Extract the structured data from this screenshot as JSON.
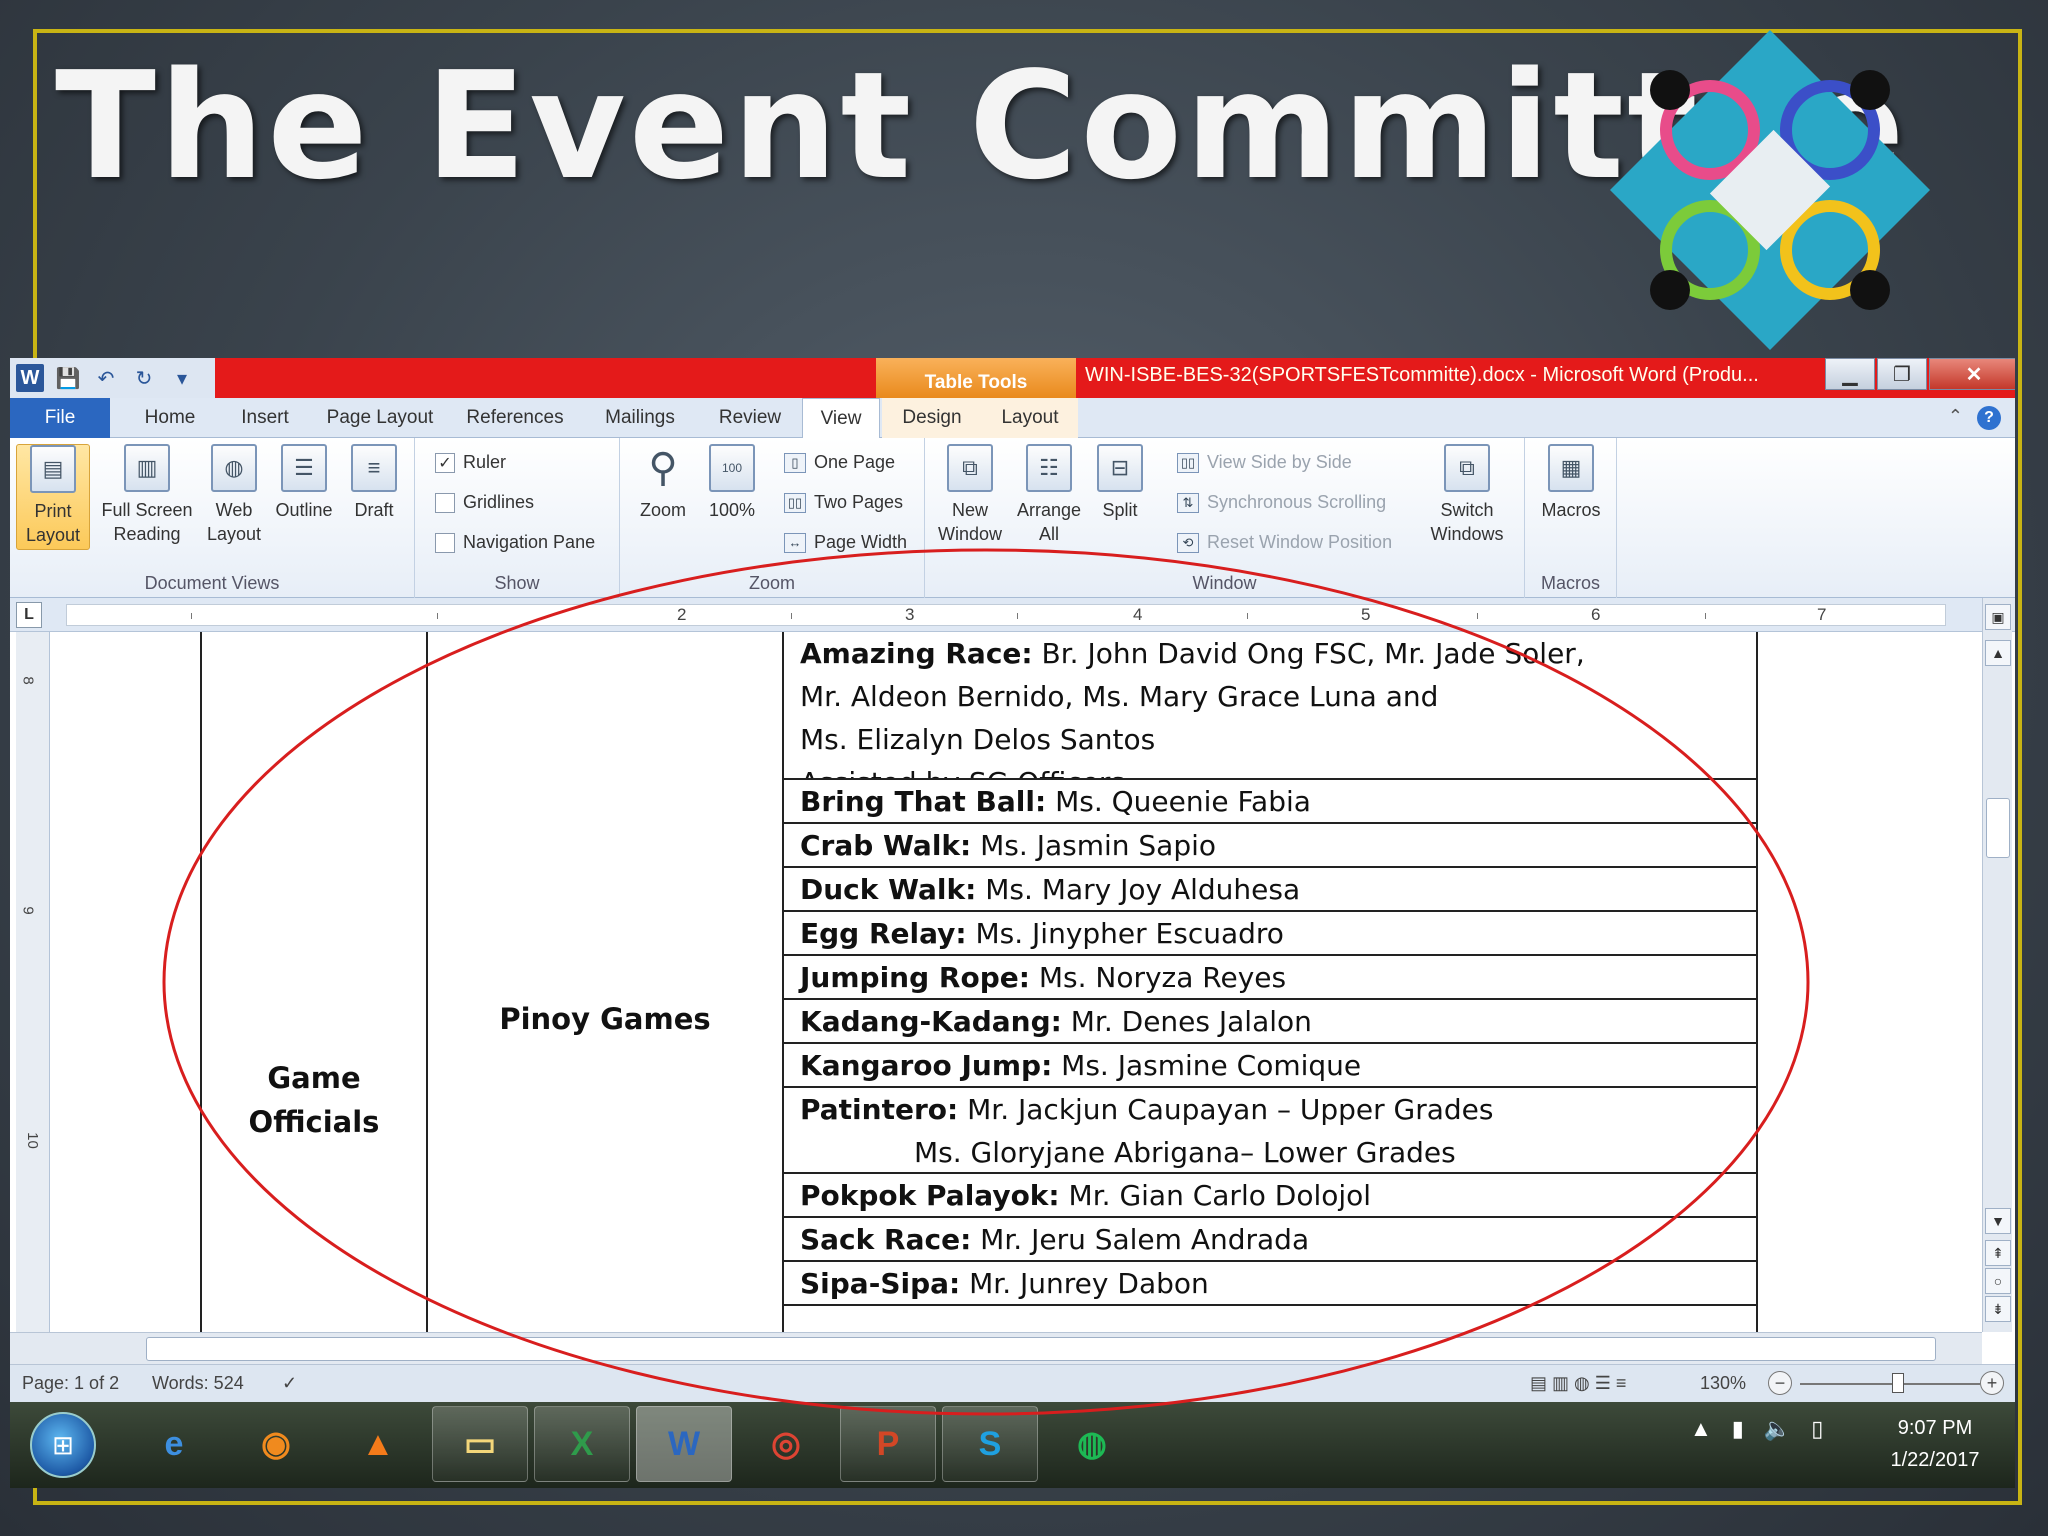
{
  "slide": {
    "title": "The Event Committee"
  },
  "word": {
    "quick_access": [
      "W",
      "💾",
      "↶",
      "↻"
    ],
    "context_tab": "Table Tools",
    "doc_title": "WIN-ISBE-BES-32(SPORTSFESTcommitte).docx - Microsoft Word (Produ...",
    "tabs": {
      "file": "File",
      "home": "Home",
      "insert": "Insert",
      "page_layout": "Page Layout",
      "references": "References",
      "mailings": "Mailings",
      "review": "Review",
      "view": "View",
      "design": "Design",
      "layout": "Layout"
    },
    "ribbon": {
      "doc_views": {
        "label": "Document Views",
        "print_layout": "Print Layout",
        "full_screen": "Full Screen Reading",
        "web_layout": "Web Layout",
        "outline": "Outline",
        "draft": "Draft"
      },
      "show": {
        "label": "Show",
        "ruler": "Ruler",
        "gridlines": "Gridlines",
        "nav_pane": "Navigation Pane"
      },
      "zoom": {
        "label": "Zoom",
        "zoom": "Zoom",
        "hundred": "100%",
        "one_page": "One Page",
        "two_pages": "Two Pages",
        "page_width": "Page Width"
      },
      "window": {
        "label": "Window",
        "new_window": "New Window",
        "arrange_all": "Arrange All",
        "split": "Split",
        "view_side": "View Side by Side",
        "sync_scroll": "Synchronous Scrolling",
        "reset_pos": "Reset Window Position",
        "switch_windows": "Switch Windows"
      },
      "macros": {
        "label": "Macros",
        "macros": "Macros"
      }
    },
    "ruler_numbers": [
      "2",
      "3",
      "4",
      "5",
      "6",
      "7"
    ],
    "vruler_numbers": [
      "8",
      "9",
      "10"
    ],
    "table": {
      "col1": "Game Officials",
      "col2": "Pinoy Games",
      "rows": [
        {
          "event": "Amazing Race:",
          "people": "  Br. John David Ong FSC, Mr. Jade Soler,",
          "extra": [
            "Mr. Aldeon Bernido, Ms. Mary Grace Luna and",
            "Ms. Elizalyn Delos Santos",
            "Assisted by SG Officers"
          ]
        },
        {
          "event": "Bring That Ball:",
          "people": " Ms. Queenie Fabia"
        },
        {
          "event": "Crab Walk:",
          "people": " Ms. Jasmin Sapio"
        },
        {
          "event": "Duck Walk:",
          "people": " Ms. Mary Joy Alduhesa"
        },
        {
          "event": "Egg Relay:",
          "people": " Ms. Jinypher Escuadro"
        },
        {
          "event": "Jumping Rope:",
          "people": " Ms. Noryza Reyes"
        },
        {
          "event": "Kadang-Kadang:",
          "people": " Mr. Denes Jalalon"
        },
        {
          "event": "Kangaroo Jump:",
          "people": " Ms. Jasmine Comique"
        },
        {
          "event": "Patintero:",
          "people": " Mr. Jackjun Caupayan – Upper Grades",
          "extra": [
            "Ms. Gloryjane Abrigana– Lower Grades"
          ],
          "indent": true
        },
        {
          "event": "Pokpok Palayok:",
          "people": " Mr. Gian Carlo Dolojol"
        },
        {
          "event": "Sack Race:",
          "people": " Mr. Jeru Salem Andrada"
        },
        {
          "event": "Sipa-Sipa:",
          "people": " Mr. Junrey Dabon"
        }
      ]
    },
    "status": {
      "page": "Page: 1 of 2",
      "words": "Words: 524",
      "zoom": "130%"
    }
  },
  "taskbar": {
    "apps": [
      "IE",
      "Firefox",
      "VLC",
      "Explorer",
      "Excel",
      "Word",
      "Chrome",
      "PowerPoint",
      "Skype",
      "Spotify"
    ],
    "time": "9:07 PM",
    "date": "1/22/2017"
  },
  "colors": {
    "title_bar": "#e41a1a",
    "context": "#f0a040",
    "file_tab": "#2b67c0",
    "ellipse": "#d81e1e",
    "slide_frame": "#c8b414"
  }
}
